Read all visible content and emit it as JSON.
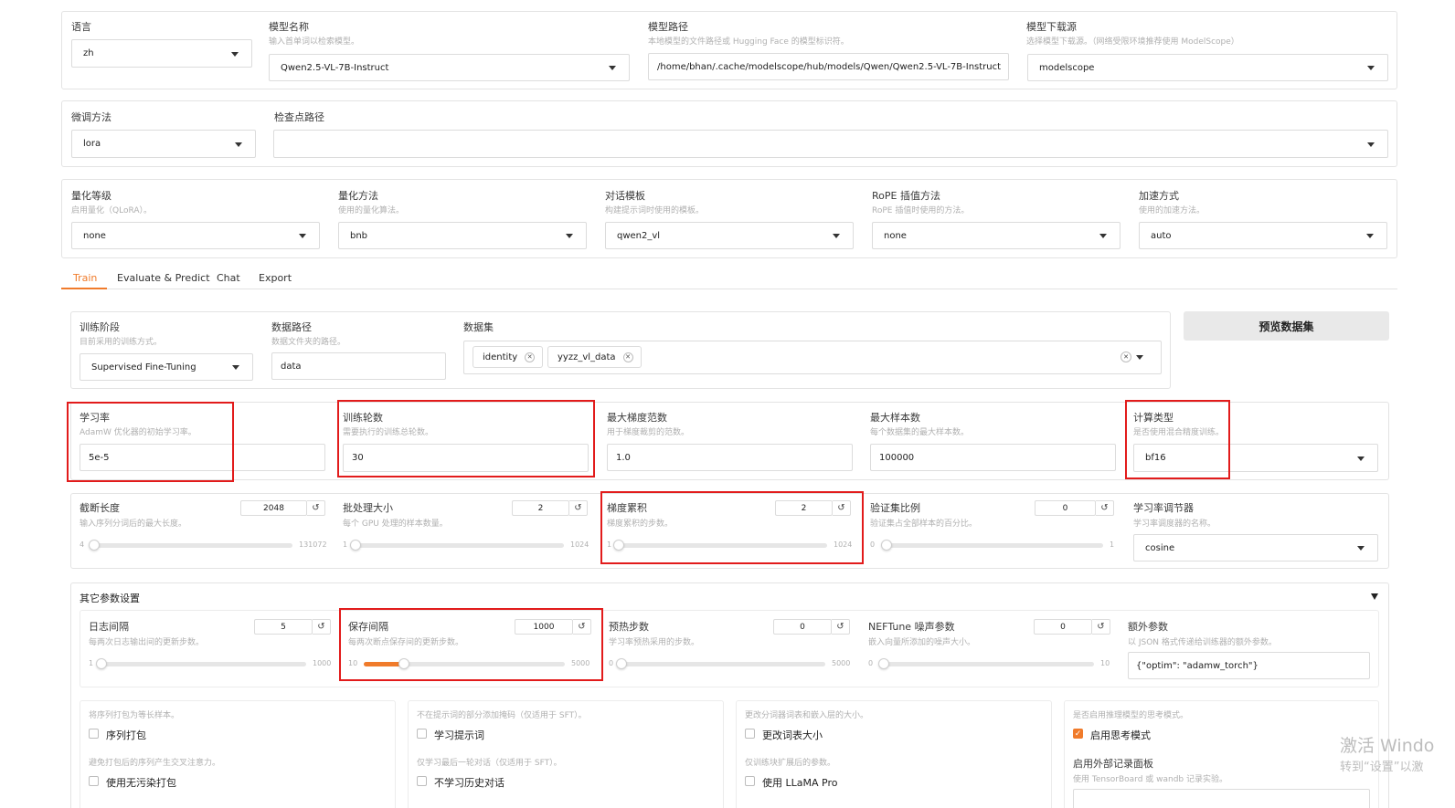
{
  "top": {
    "language": {
      "label": "语言",
      "value": "zh"
    },
    "model_name": {
      "label": "模型名称",
      "info": "输入首单词以检索模型。",
      "value": "Qwen2.5-VL-7B-Instruct"
    },
    "model_path": {
      "label": "模型路径",
      "info": "本地模型的文件路径或 Hugging Face 的模型标识符。",
      "value": "/home/bhan/.cache/modelscope/hub/models/Qwen/Qwen2.5-VL-7B-Instruct"
    },
    "hub": {
      "label": "模型下载源",
      "info": "选择模型下载源。（网络受限环境推荐使用 ModelScope）",
      "value": "modelscope"
    }
  },
  "row2": {
    "finetune": {
      "label": "微调方法",
      "value": "lora"
    },
    "checkpoint": {
      "label": "检查点路径",
      "value": ""
    }
  },
  "row3": {
    "quant_bit": {
      "label": "量化等级",
      "info": "启用量化（QLoRA）。",
      "value": "none"
    },
    "quant_method": {
      "label": "量化方法",
      "info": "使用的量化算法。",
      "value": "bnb"
    },
    "template": {
      "label": "对话模板",
      "info": "构建提示词时使用的模板。",
      "value": "qwen2_vl"
    },
    "rope": {
      "label": "RoPE 插值方法",
      "info": "RoPE 插值时使用的方法。",
      "value": "none"
    },
    "booster": {
      "label": "加速方式",
      "info": "使用的加速方法。",
      "value": "auto"
    }
  },
  "tabs": [
    "Train",
    "Evaluate & Predict",
    "Chat",
    "Export"
  ],
  "train": {
    "stage": {
      "label": "训练阶段",
      "info": "目前采用的训练方式。",
      "value": "Supervised Fine-Tuning"
    },
    "dataset_dir": {
      "label": "数据路径",
      "info": "数据文件夹的路径。",
      "value": "data"
    },
    "dataset": {
      "label": "数据集",
      "tags": [
        "identity",
        "yyzz_vl_data"
      ]
    },
    "preview_btn": "预览数据集",
    "learning_rate": {
      "label": "学习率",
      "info": "AdamW 优化器的初始学习率。",
      "value": "5e-5"
    },
    "epochs": {
      "label": "训练轮数",
      "info": "需要执行的训练总轮数。",
      "value": "30"
    },
    "max_grad_norm": {
      "label": "最大梯度范数",
      "info": "用于梯度裁剪的范数。",
      "value": "1.0"
    },
    "max_samples": {
      "label": "最大样本数",
      "info": "每个数据集的最大样本数。",
      "value": "100000"
    },
    "compute_type": {
      "label": "计算类型",
      "info": "是否使用混合精度训练。",
      "value": "bf16"
    },
    "cutoff_len": {
      "label": "截断长度",
      "info": "输入序列分词后的最大长度。",
      "value": "2048",
      "min": "4",
      "max": "131072",
      "level": 0.0156
    },
    "batch_size": {
      "label": "批处理大小",
      "info": "每个 GPU 处理的样本数量。",
      "value": "2",
      "min": "1",
      "max": "1024",
      "level": 0.001
    },
    "grad_accum": {
      "label": "梯度累积",
      "info": "梯度累积的步数。",
      "value": "2",
      "min": "1",
      "max": "1024",
      "level": 0.001
    },
    "val_size": {
      "label": "验证集比例",
      "info": "验证集占全部样本的百分比。",
      "value": "0",
      "min": "0",
      "max": "1",
      "level": 0.0
    },
    "lr_scheduler": {
      "label": "学习率调节器",
      "info": "学习率调度器的名称。",
      "value": "cosine"
    }
  },
  "extra": {
    "title": "其它参数设置",
    "logging_steps": {
      "label": "日志间隔",
      "info": "每两次日志输出间的更新步数。",
      "value": "5",
      "min": "1",
      "max": "1000",
      "level": 0.004
    },
    "save_steps": {
      "label": "保存间隔",
      "info": "每两次断点保存间的更新步数。",
      "value": "1000",
      "min": "10",
      "max": "5000",
      "level": 0.198
    },
    "warmup_steps": {
      "label": "预热步数",
      "info": "学习率预热采用的步数。",
      "value": "0",
      "min": "0",
      "max": "5000",
      "level": 0.0
    },
    "neftune": {
      "label": "NEFTune 噪声参数",
      "info": "嵌入向量所添加的噪声大小。",
      "value": "0",
      "min": "0",
      "max": "10",
      "level": 0.0
    },
    "extra_args": {
      "label": "额外参数",
      "info": "以 JSON 格式传递给训练器的额外参数。",
      "value": "{\"optim\": \"adamw_torch\"}"
    },
    "packing": {
      "info": "将序列打包为等长样本。",
      "label": "序列打包"
    },
    "neat_packing": {
      "info": "避免打包后的序列产生交叉注意力。",
      "label": "使用无污染打包"
    },
    "train_on_prompt": {
      "info": "不在提示词的部分添加掩码（仅适用于 SFT）。",
      "label": "学习提示词"
    },
    "mask_history": {
      "info": "仅学习最后一轮对话（仅适用于 SFT）。",
      "label": "不学习历史对话"
    },
    "resize_vocab": {
      "info": "更改分词器词表和嵌入层的大小。",
      "label": "更改词表大小"
    },
    "use_llama_pro": {
      "info": "仅训练块扩展后的参数。",
      "label": "使用 LLaMA Pro"
    },
    "enable_thinking": {
      "info": "是否启用推理模型的思考模式。",
      "label": "启用思考模式"
    },
    "report_to": {
      "label": "启用外部记录面板",
      "info": "使用 TensorBoard 或 wandb 记录实验。"
    }
  },
  "watermark": {
    "line1": "激活 Windo",
    "line2": "转到“设置”以激"
  }
}
